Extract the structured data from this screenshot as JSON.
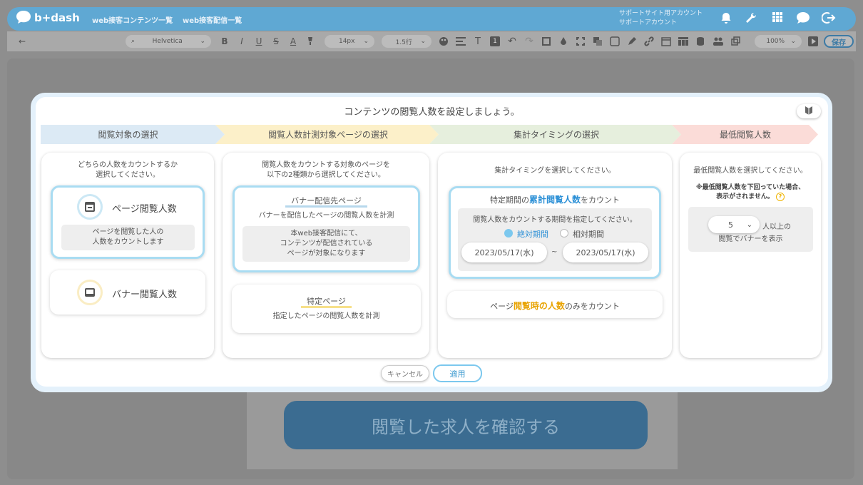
{
  "nav": {
    "logo": "b+dash",
    "links": [
      "web接客コンテンツ一覧",
      "web接客配信一覧"
    ],
    "support_line1": "サポートサイト用アカウント",
    "support_line2": "サポートアカウント"
  },
  "toolbar": {
    "back": "←",
    "font": "Helvetica",
    "size": "14px",
    "line_height": "1.5行",
    "zoom": "100%",
    "save": "保存"
  },
  "background": {
    "cta": "閲覧した求人を確認する"
  },
  "modal": {
    "title": "コンテンツの閲覧人数を設定しましょう。",
    "steps": [
      "閲覧対象の選択",
      "閲覧人数計測対象ページの選択",
      "集計タイミングの選択",
      "最低閲覧人数"
    ],
    "col1": {
      "desc1": "どちらの人数をカウントするか",
      "desc2": "選択してください。",
      "opt1": {
        "label": "ページ閲覧人数",
        "note1": "ページを閲覧した人の",
        "note2": "人数をカウントします"
      },
      "opt2": {
        "label": "バナー閲覧人数"
      }
    },
    "col2": {
      "desc1": "閲覧人数をカウントする対象のページを",
      "desc2": "以下の2種類から選択してください。",
      "opt1": {
        "label": "バナー配信先ページ",
        "sub": "バナーを配信したページの閲覧人数を計測",
        "note1": "本web接客配信にて、",
        "note2": "コンテンツが配信されている",
        "note3": "ページが対象になります"
      },
      "opt2": {
        "label": "特定ページ",
        "sub": "指定したページの閲覧人数を計測"
      }
    },
    "col3": {
      "desc": "集計タイミングを選択してください。",
      "opt1": {
        "pre": "特定期間の",
        "em": "累計閲覧人数",
        "post": "をカウント",
        "period_desc": "閲覧人数をカウントする期間を指定してください。",
        "radio_abs": "絶対期間",
        "radio_rel": "相対期間",
        "date_from": "2023/05/17(水)",
        "tilde": "~",
        "date_to": "2023/05/17(水)"
      },
      "opt2": {
        "pre": "ページ",
        "em": "閲覧時の人数",
        "post": "のみをカウント"
      }
    },
    "col4": {
      "desc": "最低閲覧人数を選択してください。",
      "note1": "※最低閲覧人数を下回っていた場合、",
      "note2": "表示がされません。",
      "help": "?",
      "value": "5",
      "suffix": "人以上の",
      "line2": "閲覧でバナーを表示"
    },
    "cancel": "キャンセル",
    "apply": "適用"
  },
  "colors": {
    "accent": "#5fa8d3",
    "blue_em": "#2a8fd6",
    "orange_em": "#e8a300",
    "selected_border": "#a9dcf2"
  }
}
